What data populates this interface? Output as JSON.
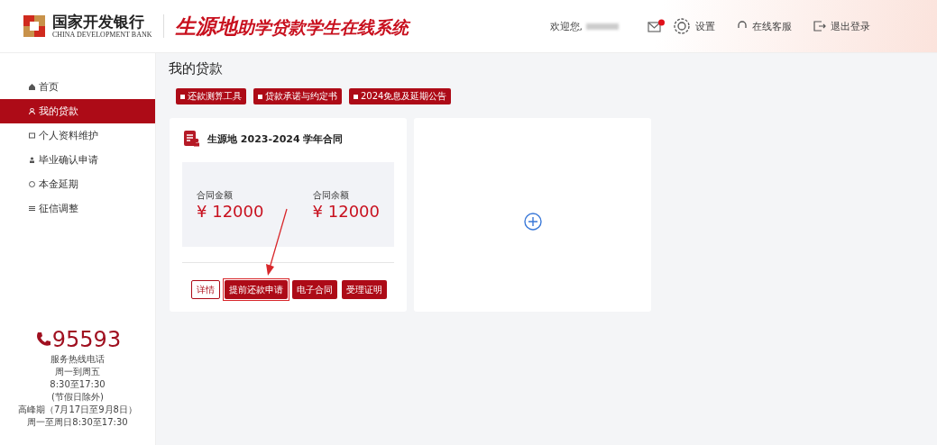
{
  "header": {
    "bank_name": "国家开发银行",
    "bank_name_en": "CHINA DEVELOPMENT BANK",
    "system_title_bold": "生源地",
    "system_title_rest": "助学贷款学生在线系统",
    "welcome": "欢迎您,",
    "mail_unread": true,
    "settings": "设置",
    "service": "在线客服",
    "logout": "退出登录"
  },
  "sidebar": {
    "items": [
      {
        "label": "首页",
        "selected": false
      },
      {
        "label": "我的贷款",
        "selected": true
      },
      {
        "label": "个人资料维护",
        "selected": false
      },
      {
        "label": "毕业确认申请",
        "selected": false
      },
      {
        "label": "本金延期",
        "selected": false
      },
      {
        "label": "征信调整",
        "selected": false
      }
    ],
    "hotline": {
      "number": "95593",
      "lines": [
        "服务热线电话",
        "周一到周五",
        "8:30至17:30",
        "(节假日除外)",
        "高峰期（7月17日至9月8日）",
        "周一至周日8:30至17:30"
      ]
    }
  },
  "main": {
    "title": "我的贷款",
    "tool_buttons": [
      "还款测算工具",
      "贷款承诺与约定书",
      "2024免息及延期公告"
    ],
    "contract": {
      "title": "生源地 2023-2024 学年合同",
      "amounts": [
        {
          "label": "合同金额",
          "value": "¥ 12000"
        },
        {
          "label": "合同余额",
          "value": "¥ 12000"
        }
      ],
      "actions": [
        {
          "label": "详情",
          "kind": "outline",
          "highlighted": false
        },
        {
          "label": "提前还款申请",
          "kind": "filled",
          "highlighted": true
        },
        {
          "label": "电子合同",
          "kind": "filled",
          "highlighted": false
        },
        {
          "label": "受理证明",
          "kind": "filled",
          "highlighted": false
        }
      ]
    }
  }
}
